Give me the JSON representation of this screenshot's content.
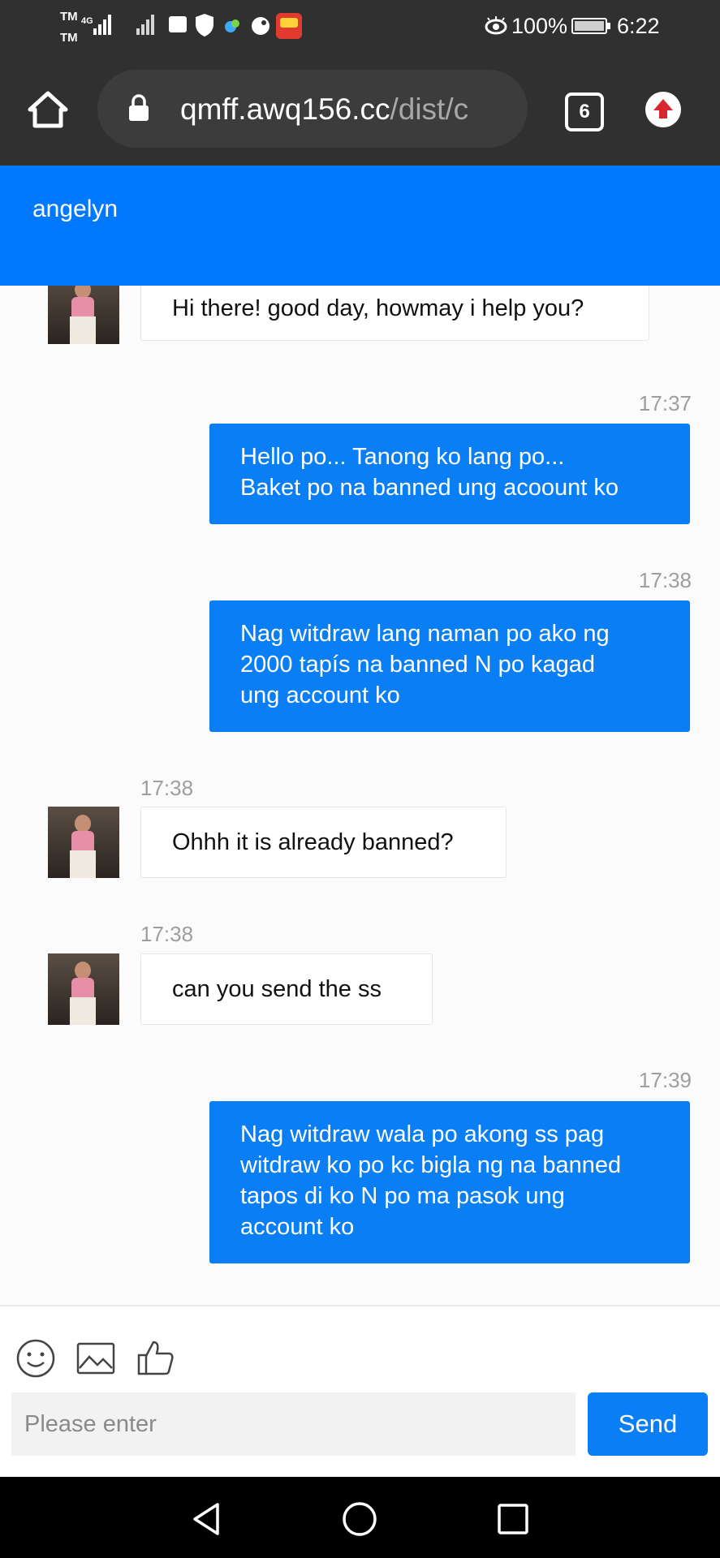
{
  "status_bar": {
    "carrier_top": "TM",
    "network": "4G",
    "carrier_bottom": "TM",
    "battery": "100%",
    "time": "6:22"
  },
  "browser": {
    "url_host": "qmff.awq156.cc",
    "url_path": "/dist/c",
    "tab_count": "6"
  },
  "chat": {
    "agent_name": "angelyn",
    "messages": [
      {
        "from": "agent",
        "time": "",
        "text": "Hi there! good day, howmay i help you?"
      },
      {
        "from": "user",
        "time": "17:37",
        "lines": [
          "Hello po... Tanong ko lang po...",
          "Baket po na banned ung acoount ko"
        ]
      },
      {
        "from": "user",
        "time": "17:38",
        "lines": [
          "Nag witdraw lang naman po ako ng",
          "2000 tapís na banned N po kagad",
          "ung account ko"
        ]
      },
      {
        "from": "agent",
        "time": "17:38",
        "text": "Ohhh it is already banned?"
      },
      {
        "from": "agent",
        "time": "17:38",
        "text": "can you send the ss"
      },
      {
        "from": "user",
        "time": "17:39",
        "lines": [
          "Nag witdraw wala po akong ss pag",
          "witdraw ko po kc bigla ng na banned",
          "tapos di ko N po ma pasok ung",
          "account ko"
        ]
      }
    ]
  },
  "composer": {
    "placeholder": "Please enter",
    "send_label": "Send"
  },
  "colors": {
    "accent": "#0a7ff5",
    "header_blue": "#0078ff",
    "browser_dark": "#303030"
  }
}
